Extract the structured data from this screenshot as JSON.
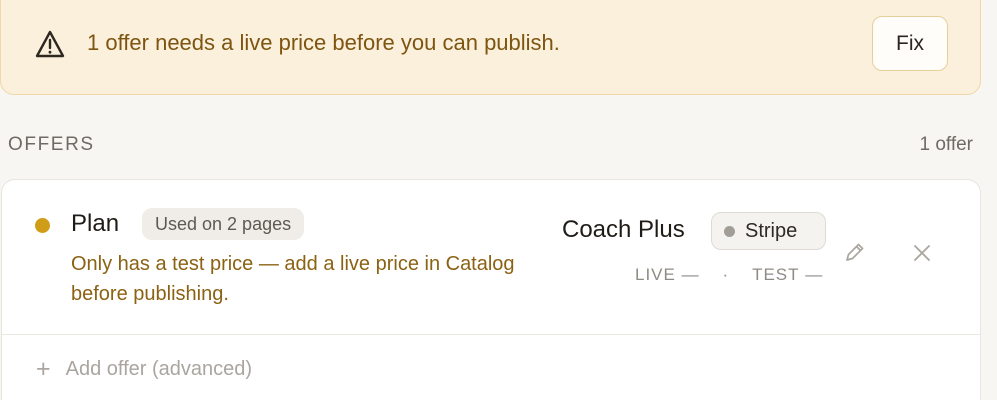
{
  "banner": {
    "message": "1 offer needs a live price before you can publish.",
    "fix_label": "Fix",
    "icon": "warning-triangle-icon"
  },
  "offers_section": {
    "title": "OFFERS",
    "count": "1 offer"
  },
  "offers": [
    {
      "name": "Plan",
      "usage": "Used on 2 pages",
      "warning": "Only has a test price — add a live price in Catalog before publishing.",
      "product": "Coach Plus",
      "provider": "Stripe",
      "live_label": "LIVE",
      "live_value": "—",
      "separator": "·",
      "test_label": "TEST",
      "test_value": "—",
      "status_color": "#d09d18"
    }
  ],
  "add_offer_label": "Add offer (advanced)",
  "colors": {
    "banner_bg": "#fbf0dc",
    "banner_text": "#7d5510",
    "warning_text": "#8b6213",
    "accent": "#d09d18"
  }
}
